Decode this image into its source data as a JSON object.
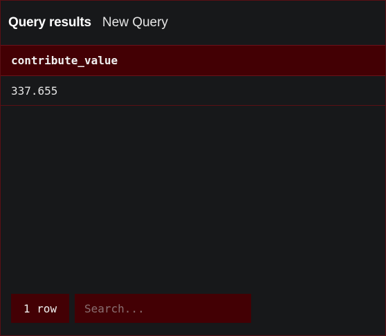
{
  "header": {
    "active_tab": "Query results",
    "inactive_tab": "New Query"
  },
  "table": {
    "columns": [
      "contribute_value"
    ],
    "rows": [
      [
        "337.655"
      ]
    ]
  },
  "footer": {
    "row_count": "1 row",
    "search_placeholder": "Search..."
  },
  "colors": {
    "background": "#17181a",
    "accent": "#430004",
    "border": "#5a0f14"
  }
}
